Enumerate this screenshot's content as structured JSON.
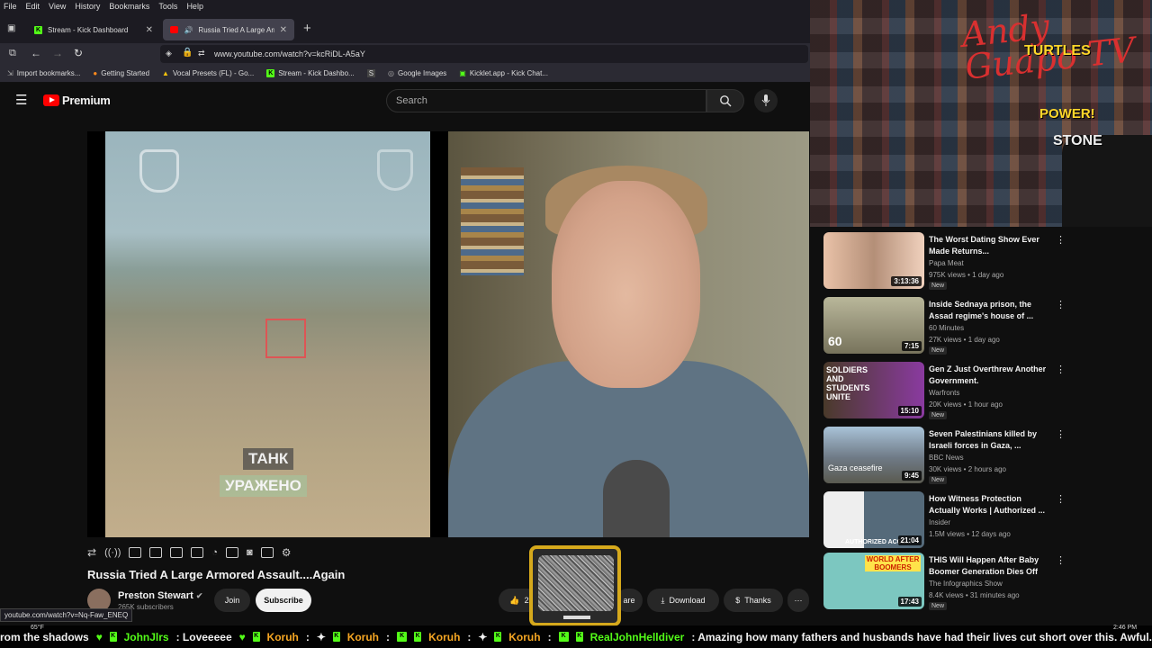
{
  "menu": [
    "File",
    "Edit",
    "View",
    "History",
    "Bookmarks",
    "Tools",
    "Help"
  ],
  "tabs": [
    {
      "label": "Stream - Kick Dashboard"
    },
    {
      "label": "Russia Tried A Large Armored"
    }
  ],
  "url": "www.youtube.com/watch?v=kcRiDL-A5aY",
  "bookmarks": [
    "Import bookmarks...",
    "Getting Started",
    "Vocal Presets (FL) - Go...",
    "Stream - Kick Dashbo...",
    "S",
    "Google Images",
    "Kicklet.app - Kick Chat..."
  ],
  "youtube": {
    "logo_label": "Premium",
    "search_placeholder": "Search"
  },
  "video": {
    "overlay_tank": "ТАНК",
    "overlay_hit": "УРАЖЕНО",
    "title": "Russia Tried A Large Armored Assault....Again",
    "channel": "Preston Stewart",
    "subscribers": "265K subscribers",
    "join": "Join",
    "subscribe": "Subscribe",
    "likes": "2",
    "share": "are",
    "download": "Download",
    "thanks": "Thanks"
  },
  "stream_overlay": {
    "signature": "Andy Guapo TV",
    "turtles": "TURTLES",
    "power": "POWER!",
    "stone": "STONE"
  },
  "recommendations": [
    {
      "title": "The Worst Dating Show Ever Made Returns...",
      "channel": "Papa Meat",
      "meta": "975K views • 1 day ago",
      "duration": "3:13:36",
      "badge": "New",
      "thumb_color": "#c9a38a"
    },
    {
      "title": "Inside Sednaya prison, the Assad regime's house of ...",
      "channel": "60 Minutes",
      "meta": "27K views • 1 day ago",
      "duration": "7:15",
      "badge": "New",
      "thumb_color": "#8f8a6e",
      "thumb_text": "60"
    },
    {
      "title": "Gen Z Just Overthrew Another Government.",
      "channel": "Warfronts",
      "meta": "20K views • 1 hour ago",
      "duration": "15:10",
      "badge": "New",
      "thumb_color": "#3a2f4a",
      "thumb_text": "SOLDIERS AND STUDENTS UNITE"
    },
    {
      "title": "Seven Palestinians killed by Israeli forces in Gaza, ...",
      "channel": "BBC News",
      "meta": "30K views • 2 hours ago",
      "duration": "9:45",
      "badge": "New",
      "thumb_color": "#6f7a86",
      "thumb_text": "Gaza ceasefire"
    },
    {
      "title": "How Witness Protection Actually Works | Authorized ...",
      "channel": "Insider",
      "meta": "1.5M views • 12 days ago",
      "duration": "21:04",
      "badge": "",
      "thumb_color": "#7a6a5a",
      "thumb_text": "AUTHORIZED ACCE..."
    },
    {
      "title": "THIS Will Happen After Baby Boomer Generation Dies Off",
      "channel": "The Infographics Show",
      "meta": "8.4K views • 31 minutes ago",
      "duration": "17:43",
      "badge": "New",
      "thumb_color": "#7cc7c0",
      "thumb_text": "WORLD AFTER BOOMERS"
    }
  ],
  "status_url": "youtube.com/watch?v=Nq-Faw_ENEQ",
  "ticker": [
    {
      "user": "",
      "text": "rom the shadows"
    },
    {
      "user": "JohnJlrs",
      "text": ": Loveeeee"
    },
    {
      "user": "Koruh",
      "text": ":"
    },
    {
      "user": "Koruh",
      "text": ":"
    },
    {
      "user": "Koruh",
      "text": ":"
    },
    {
      "user": "Koruh",
      "text": ":"
    },
    {
      "user": "RealJohnHelldiver",
      "text": ": Amazing how many fathers and husbands have had their lives cut short over this. Awful."
    }
  ],
  "weather": "65°F",
  "clock": "2:46 PM",
  "colors": {
    "kick_green": "#53fc18",
    "yt_red": "#ff0000",
    "tv_gold": "#d6a91c"
  }
}
